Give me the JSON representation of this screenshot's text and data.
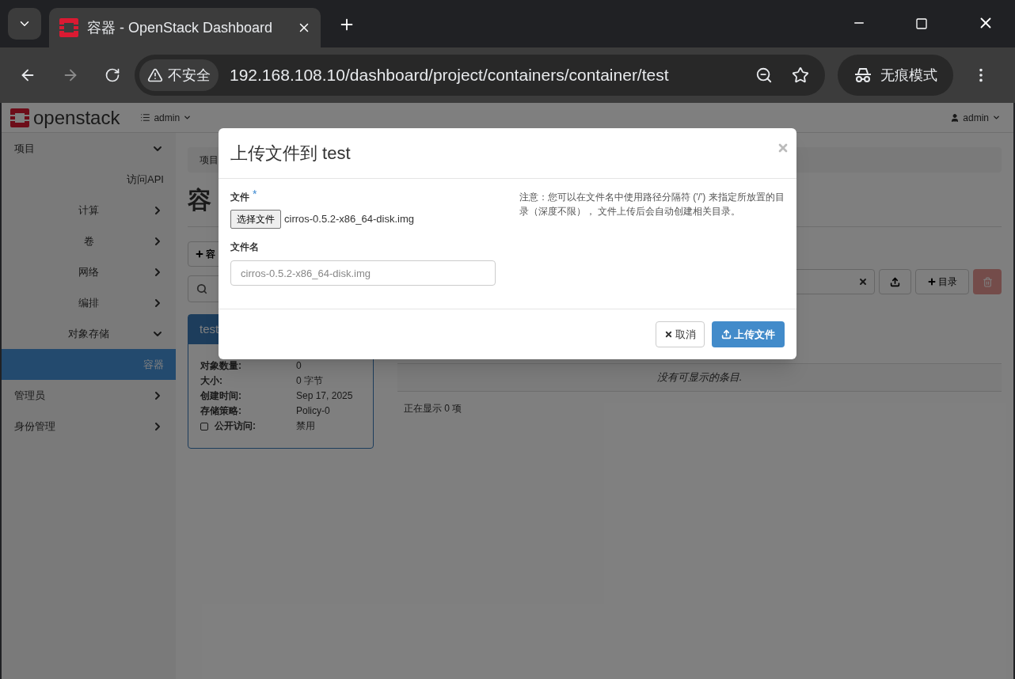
{
  "browser": {
    "tab_title": "容器 - OpenStack Dashboard",
    "security_label": "不安全",
    "url": "192.168.108.10/dashboard/project/containers/container/test",
    "incognito_label": "无痕模式"
  },
  "navbar": {
    "logo": "openstack",
    "project_menu": "admin",
    "user_menu": "admin"
  },
  "sidebar": [
    {
      "label": "项目",
      "selected": false,
      "expanded": true,
      "children": [
        {
          "label": "访问API",
          "selected": false
        },
        {
          "label": "计算",
          "selected": false,
          "expanded": false
        },
        {
          "label": "卷",
          "selected": false,
          "expanded": false
        },
        {
          "label": "网络",
          "selected": false,
          "expanded": false
        },
        {
          "label": "编排",
          "selected": false,
          "expanded": false
        },
        {
          "label": "对象存储",
          "selected": false,
          "expanded": true,
          "children": [
            {
              "label": "容器",
              "selected": true
            }
          ]
        }
      ]
    },
    {
      "label": "管理员",
      "selected": false,
      "expanded": false
    },
    {
      "label": "身份管理",
      "selected": false,
      "expanded": false
    }
  ],
  "breadcrumb": "项目",
  "page_heading": "容",
  "create_button": "容",
  "container_card": {
    "title": "test",
    "details": [
      {
        "label": "对象数量:",
        "value": "0"
      },
      {
        "label": "大小:",
        "value": "0 字节"
      },
      {
        "label": "创建时间:",
        "value": "Sep 17, 2025"
      },
      {
        "label": "存储策略:",
        "value": "Policy-0"
      }
    ],
    "public_access": {
      "label": "公开访问:",
      "value": "禁用",
      "checked": false
    }
  },
  "toolbar": {
    "folder_button": "目录",
    "delete_disabled": true
  },
  "table": {
    "empty_message": "没有可显示的条目.",
    "footer": "正在显示 0 项"
  },
  "modal": {
    "title": "上传文件到 test",
    "file_label": "文件",
    "required_mark": "*",
    "choose_button": "选择文件",
    "chosen_file": "cirros-0.5.2-x86_64-disk.img",
    "name_label": "文件名",
    "name_placeholder": "cirros-0.5.2-x86_64-disk.img",
    "help": "注意：您可以在文件名中使用路径分隔符 ('/') 来指定所放置的目录（深度不限）， 文件上传后会自动创建相关目录。",
    "cancel_button": "取消",
    "submit_button": "上传文件"
  }
}
